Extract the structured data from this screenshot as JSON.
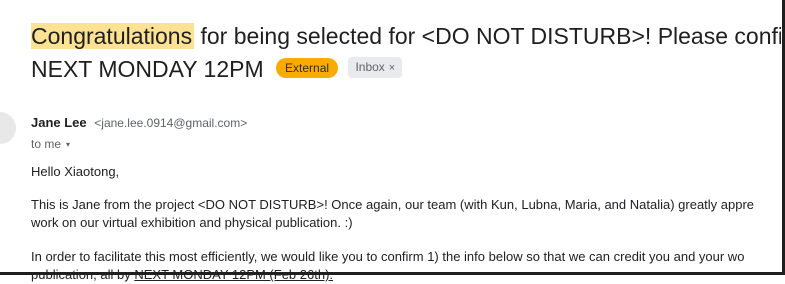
{
  "email": {
    "subject": {
      "highlight": "Congratulations",
      "rest_line1": " for being selected for <DO NOT DISTURB>! Please confirm",
      "line2": "NEXT MONDAY 12PM"
    },
    "labels": {
      "external": "External",
      "inbox": "Inbox",
      "remove_glyph": "×"
    },
    "sender": {
      "name": "Jane Lee",
      "email": "<jane.lee.0914@gmail.com>"
    },
    "recipient": {
      "to": "to me",
      "caret": "▾"
    },
    "body": {
      "greeting": "Hello Xiaotong,",
      "p1_line1": "This is Jane from the project <DO NOT DISTURB>! Once again, our team (with Kun, Lubna, Maria, and Natalia) greatly appre",
      "p1_line2": "work on our virtual exhibition and physical publication. :)",
      "p2_line1": "In order to facilitate this most efficiently, we would like you to confirm 1) the info below so that we can credit you and your wo",
      "p2_line2_pre": "publication, all by ",
      "p2_line2_link": "NEXT MONDAY 12PM (Feb 26th)."
    }
  },
  "colors": {
    "highlight": "#fde293",
    "external_badge": "#f9ab00",
    "inbox_badge": "#e8eaed",
    "text": "#202124",
    "muted": "#5f6368"
  }
}
